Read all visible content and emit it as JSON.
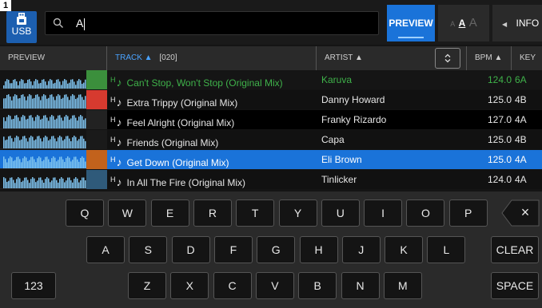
{
  "deck_number": "1",
  "source": {
    "label": "USB",
    "icon": "usb-drive-icon"
  },
  "search": {
    "query": "A",
    "icon": "search-icon"
  },
  "toolbar": {
    "preview_label": "PREVIEW",
    "font_small": "A",
    "font_medium": "A",
    "font_large": "A",
    "info_label": "INFO",
    "info_icon": "triangle-left-icon"
  },
  "columns": {
    "preview": "PREVIEW",
    "track": "TRACK ▲",
    "track_count": "[020]",
    "artist": "ARTIST ▲",
    "sort_icon": "sort-toggle-icon",
    "bpm": "BPM ▲",
    "key": "KEY ▲"
  },
  "tracks": [
    {
      "title": "Can't Stop, Won't Stop (Original Mix)",
      "artist": "Karuva",
      "bpm": "124.0",
      "key": "6A",
      "state": "playing",
      "art_color": "#3b8f3c"
    },
    {
      "title": "Extra Trippy (Original Mix)",
      "artist": "Danny Howard",
      "bpm": "125.0",
      "key": "4B",
      "state": "normal",
      "art_color": "#d63a2f"
    },
    {
      "title": "Feel Alright (Original Mix)",
      "artist": "Franky Rizardo",
      "bpm": "127.0",
      "key": "4A",
      "state": "normal",
      "art_color": "#222222"
    },
    {
      "title": "Friends  (Original Mix)",
      "artist": "Capa",
      "bpm": "125.0",
      "key": "4B",
      "state": "normal",
      "art_color": "#1a1a1a"
    },
    {
      "title": "Get Down (Original Mix)",
      "artist": "Eli Brown",
      "bpm": "125.0",
      "key": "4A",
      "state": "selected",
      "art_color": "#c2621c"
    },
    {
      "title": "In All The Fire (Original Mix)",
      "artist": "Tinlicker",
      "bpm": "124.0",
      "key": "4A",
      "state": "normal",
      "art_color": "#2f5a7a"
    }
  ],
  "keyboard": {
    "row1": [
      "Q",
      "W",
      "E",
      "R",
      "T",
      "Y",
      "U",
      "I",
      "O",
      "P"
    ],
    "row2": [
      "A",
      "S",
      "D",
      "F",
      "G",
      "H",
      "J",
      "K",
      "L"
    ],
    "row3": [
      "Z",
      "X",
      "C",
      "V",
      "B",
      "N",
      "M"
    ],
    "numbers_label": "123",
    "backspace_label": "×",
    "clear_label": "CLEAR",
    "space_label": "SPACE"
  },
  "colors": {
    "accent": "#1a73d9",
    "playing": "#3fb24a"
  }
}
